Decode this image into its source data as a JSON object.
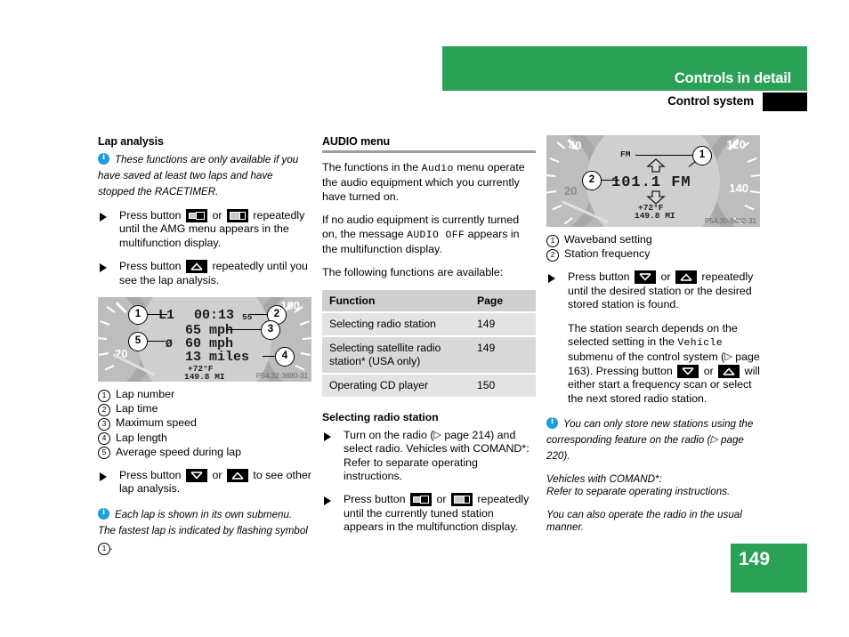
{
  "header": {
    "band_title": "Controls in detail",
    "sub_title": "Control system",
    "green": "#2ba158"
  },
  "page_number": "149",
  "left_column": {
    "heading": "Lap analysis",
    "note1": "These functions are only available if you have saved at least two laps and have stopped the RACETIMER.",
    "step1_a": "Press button",
    "step1_or": "or",
    "step1_b": "repeatedly until the AMG menu appears in the multifunction display.",
    "step2_a": "Press button",
    "step2_b": "repeatedly until you see the lap analysis.",
    "figure": {
      "code": "P54.32-3880-31",
      "lap_label": "L1",
      "lap_time": "00:13",
      "small_num": "55",
      "max_speed": "65 mph",
      "avg_symbol": "Ø",
      "avg_speed": "60 mph",
      "lap_length": "13 miles",
      "temp": "+72°F",
      "odometer": "149.8 MI",
      "gauge_left_num": "20",
      "gauge_right_num": "100",
      "callouts": [
        "1",
        "2",
        "3",
        "4",
        "5"
      ]
    },
    "legend": [
      {
        "n": "1",
        "label": "Lap number"
      },
      {
        "n": "2",
        "label": "Lap time"
      },
      {
        "n": "3",
        "label": "Maximum speed"
      },
      {
        "n": "4",
        "label": "Lap length"
      },
      {
        "n": "5",
        "label": "Average speed during lap"
      }
    ],
    "step3_a": "Press button",
    "step3_or": "or",
    "step3_b": "to see other lap analysis.",
    "note2_pre": "Each lap is shown in its own submenu. The fastest lap is indicated by flashing symbol",
    "note2_num": "1",
    "note2_post": "."
  },
  "middle_column": {
    "heading": "AUDIO menu",
    "para1_a": "The functions in the",
    "para1_mono": "Audio",
    "para1_b": "menu operate the audio equipment which you currently have turned on.",
    "para2_a": "If no audio equipment is currently turned on, the message",
    "para2_mono": "AUDIO OFF",
    "para2_b": "appears in the multifunction display.",
    "para3": "The following functions are available:",
    "table": {
      "columns": [
        "Function",
        "Page"
      ],
      "rows": [
        {
          "function": "Selecting radio station",
          "page": "149"
        },
        {
          "function": "Selecting satellite radio station* (USA only)",
          "page": "149"
        },
        {
          "function": "Operating CD player",
          "page": "150"
        }
      ]
    },
    "sub_heading": "Selecting radio station",
    "step1_a": "Turn on the radio (",
    "step1_ref": "page 214",
    "step1_b": ") and select radio. Vehicles with COMAND*: Refer to separate operating instructions.",
    "step2_a": "Press button",
    "step2_or": "or",
    "step2_b": "repeatedly until the currently tuned station appears in the multifunction display."
  },
  "right_column": {
    "figure": {
      "code": "P54.30-8402-31",
      "band_small": "FM",
      "frequency": "101.1 FM",
      "temp": "+72°F",
      "odometer": "149.8 MI",
      "gauge_nums": [
        "40",
        "120",
        "20",
        "140"
      ],
      "callouts": [
        "1",
        "2"
      ]
    },
    "legend": [
      {
        "n": "1",
        "label": "Waveband setting"
      },
      {
        "n": "2",
        "label": "Station frequency"
      }
    ],
    "step1_a": "Press button",
    "step1_or": "or",
    "step1_b": "repeatedly until the desired station or the desired stored station is found.",
    "para_a": "The station search depends on the selected setting in the",
    "para_mono": "Vehicle",
    "para_b": "submenu of the control system (",
    "para_ref": "page 163",
    "para_c": "). Pressing button",
    "para_or": "or",
    "para_d": "will either start a frequency scan or select the next stored radio station.",
    "note_a": "You can only store new stations using the corresponding feature on the radio (",
    "note_ref": "page 220",
    "note_b": ").",
    "italic1_line1": "Vehicles with COMAND*:",
    "italic1_line2": "Refer to separate operating instructions.",
    "italic2": "You can also operate the radio in the usual manner."
  }
}
